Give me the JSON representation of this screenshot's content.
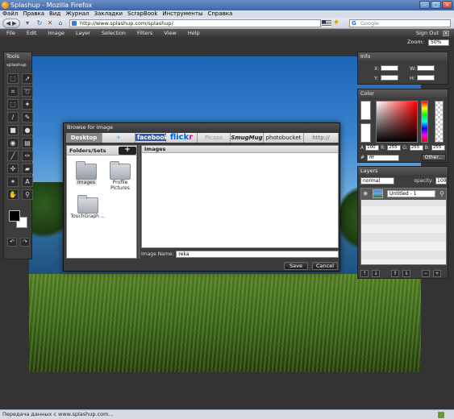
{
  "browser": {
    "window_title": "Splashup - Mozilla Firefox",
    "menu": [
      "Файл",
      "Правка",
      "Вид",
      "Журнал",
      "Закладки",
      "ScrapBook",
      "Инструменты",
      "Справка"
    ],
    "url": "http://www.splashup.com/splashup/",
    "search_placeholder": "Google",
    "status": "Передача данных с www.splashup.com..."
  },
  "app": {
    "menu": [
      "File",
      "Edit",
      "Image",
      "Layer",
      "Selection",
      "Filters",
      "View",
      "Help"
    ],
    "sign_out": "Sign Out",
    "zoom_label": "Zoom:",
    "zoom_value": "50%",
    "tools_title": "Tools",
    "logo": "splashup",
    "tool_icons": [
      "marquee-icon",
      "move-icon",
      "crop-icon",
      "lasso-icon",
      "magic-wand-icon",
      "eyedropper-icon",
      "brush-icon",
      "pencil-icon",
      "rectangle-icon",
      "ellipse-icon",
      "fill-icon",
      "gradient-icon",
      "blur-icon",
      "smudge-icon",
      "clone-icon",
      "eraser-icon",
      "stamp-icon",
      "text-icon",
      "hand-icon",
      "zoom-icon"
    ]
  },
  "info_panel": {
    "title": "Info",
    "labels": [
      "X:",
      "Y:",
      "W:",
      "H:"
    ]
  },
  "color_panel": {
    "title": "Color",
    "a_label": "A",
    "a_value": "100",
    "r_label": "R:",
    "r_value": "255",
    "g_label": "G:",
    "g_value": "255",
    "b_label": "B:",
    "b_value": "255",
    "hash": "#",
    "hex": "fff",
    "other_label": "Other..."
  },
  "layers_panel": {
    "title": "Layers",
    "blend_mode": "normal",
    "opacity_label": "opacity:",
    "opacity_value": "100",
    "layer_name": "Untitled - 1"
  },
  "dialog": {
    "title": "Browse for Image",
    "tabs": {
      "desktop": "Desktop",
      "facebook": "facebook",
      "flickr_a": "flick",
      "flickr_b": "r",
      "picasa": "Picasa",
      "smugmug": "SmugMug",
      "photobucket": "photobucket",
      "http": "http://"
    },
    "folders_header": "Folders/Sets",
    "add_label": "+",
    "folders": [
      "Images",
      "Profile Pictures",
      "TouchGraph ..."
    ],
    "images_header": "Images",
    "image_name_label": "Image Name:",
    "image_name_value": "reka",
    "save_label": "Save",
    "cancel_label": "Cancel"
  }
}
